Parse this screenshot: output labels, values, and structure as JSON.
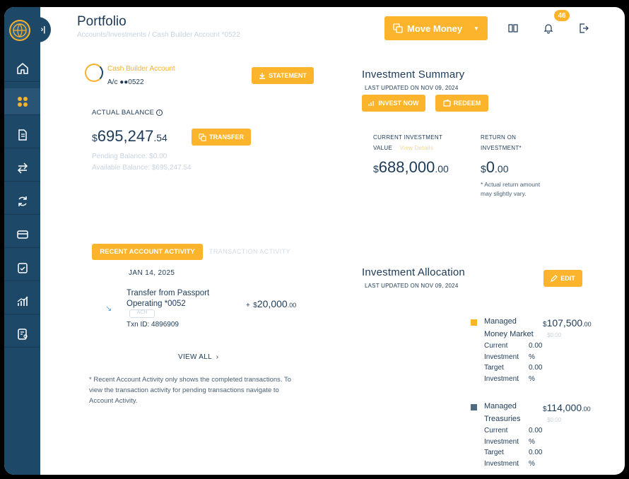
{
  "header": {
    "title": "Portfolio",
    "breadcrumb": "Accounts/Investments  /  Cash Builder Account *0522",
    "move_money_label": "Move Money",
    "notification_count": "46"
  },
  "account": {
    "name": "Cash Builder Account",
    "number_label": "A/c  ●●0522",
    "statement_label": "STATEMENT",
    "actual_balance_label": "ACTUAL BALANCE",
    "balance_currency": "$",
    "balance_main": "695,247",
    "balance_decimal": ".54",
    "transfer_label": "TRANSFER",
    "pending_balance": "Pending Balance: $0.00",
    "available_balance": "Available Balance: $695,247.54"
  },
  "investment_summary": {
    "title": "Investment Summary",
    "last_updated": "LAST UPDATED ON NOV 09, 2024",
    "invest_now_label": "INVEST NOW",
    "redeem_label": "REDEEM",
    "current_value_label": "CURRENT INVESTMENT",
    "current_value_label2": "VALUE",
    "current_value_note": "View Details",
    "current_currency": "$",
    "current_main": "688,000",
    "current_decimal": ".00",
    "return_label": "RETURN ON",
    "return_label2": "INVESTMENT*",
    "return_currency": "$",
    "return_main": "0",
    "return_decimal": ".00",
    "return_note1": "* Actual return amount",
    "return_note2": "may slightly vary."
  },
  "activity": {
    "tab_recent": "RECENT ACCOUNT ACTIVITY",
    "tab_transaction": "TRANSACTION ACTIVITY",
    "txn_date": "JAN 14, 2025",
    "txn_desc": "Transfer from Passport Operating *0052",
    "txn_pill": "ACH",
    "txn_id": "Txn ID: 4896909",
    "txn_sign": "+",
    "txn_currency": "$",
    "txn_main": "20,000",
    "txn_decimal": ".00",
    "view_all": "VIEW ALL",
    "note": "* Recent Account Activity only shows the completed transactions. To view the transaction activity for pending transactions navigate to Account Activity."
  },
  "allocation": {
    "title": "Investment Allocation",
    "last_updated": "LAST UPDATED ON NOV 09, 2024",
    "edit_label": "EDIT",
    "items": [
      {
        "name1": "Managed",
        "name2": "Money Market",
        "currency": "$",
        "main": "107,500",
        "decimal": ".00",
        "sub": "$0.00",
        "current_label1": "Current",
        "current_label2": "Investment",
        "current_value": "0.00",
        "current_unit": "%",
        "target_label1": "Target",
        "target_label2": "Investment",
        "target_value": "0.00",
        "target_unit": "%"
      },
      {
        "name1": "Managed",
        "name2": "Treasuries",
        "currency": "$",
        "main": "114,000",
        "decimal": ".00",
        "sub": "$0.00",
        "current_label1": "Current",
        "current_label2": "Investment",
        "current_value": "0.00",
        "current_unit": "%",
        "target_label1": "Target",
        "target_label2": "Investment",
        "target_value": "0.00",
        "target_unit": "%"
      }
    ]
  },
  "colors": {
    "accent": "#fbb42c",
    "sidebar": "#1e4868",
    "money_market": "#fbb42c",
    "treasuries": "#4f6b82"
  }
}
